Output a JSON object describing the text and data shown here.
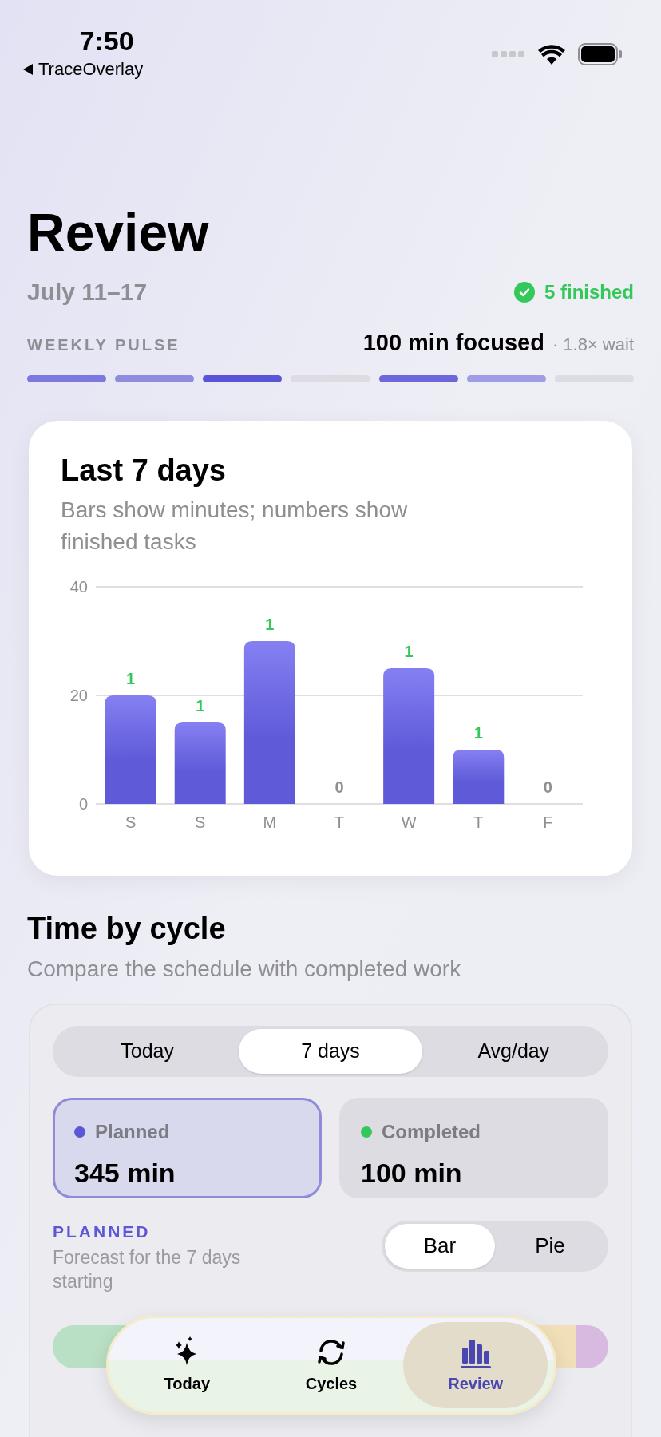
{
  "status_bar": {
    "time": "7:50",
    "back_label": "TraceOverlay"
  },
  "header": {
    "title": "Review",
    "date_range": "July 11–17",
    "finished": "5 finished"
  },
  "weekly_pulse": {
    "label": "WEEKLY PULSE",
    "focused": "100 min focused",
    "wait": "· 1.8× wait",
    "segments": [
      {
        "color": "#7b78e0"
      },
      {
        "color": "#8f8ce0"
      },
      {
        "color": "#5a55d6"
      },
      {
        "color": "#dcdce2"
      },
      {
        "color": "#6c68dc"
      },
      {
        "color": "#a09de6"
      },
      {
        "color": "#dcdce2"
      }
    ]
  },
  "last_7_days": {
    "title": "Last 7 days",
    "subtitle": "Bars show minutes; numbers show finished tasks",
    "chart_data": {
      "type": "bar",
      "categories": [
        "S",
        "S",
        "M",
        "T",
        "W",
        "T",
        "F"
      ],
      "values": [
        20,
        15,
        30,
        0,
        25,
        10,
        0
      ],
      "ylim": [
        0,
        40
      ],
      "yticks": [
        0,
        20,
        40
      ]
    },
    "finished_counts": [
      "1",
      "1",
      "1",
      "0",
      "1",
      "1",
      "0"
    ]
  },
  "time_by_cycle": {
    "title": "Time by cycle",
    "subtitle": "Compare the schedule with completed work",
    "ranges": [
      {
        "label": "Today",
        "selected": false
      },
      {
        "label": "7 days",
        "selected": true
      },
      {
        "label": "Avg/day",
        "selected": false
      }
    ],
    "stats": [
      {
        "label": "Planned",
        "value": "345 min",
        "color": "#5b57d6",
        "selected": true
      },
      {
        "label": "Completed",
        "value": "100 min",
        "color": "#34c759",
        "selected": false
      }
    ],
    "section_label": "PLANNED",
    "section_note": "Forecast for the 7 days starting",
    "chart_styles": [
      {
        "label": "Bar",
        "selected": true
      },
      {
        "label": "Pie",
        "selected": false
      }
    ]
  },
  "tab_bar": [
    {
      "label": "Today",
      "kind": "sparkles",
      "selected": false
    },
    {
      "label": "Cycles",
      "kind": "cycle",
      "selected": false
    },
    {
      "label": "Review",
      "kind": "chart",
      "selected": true
    }
  ]
}
